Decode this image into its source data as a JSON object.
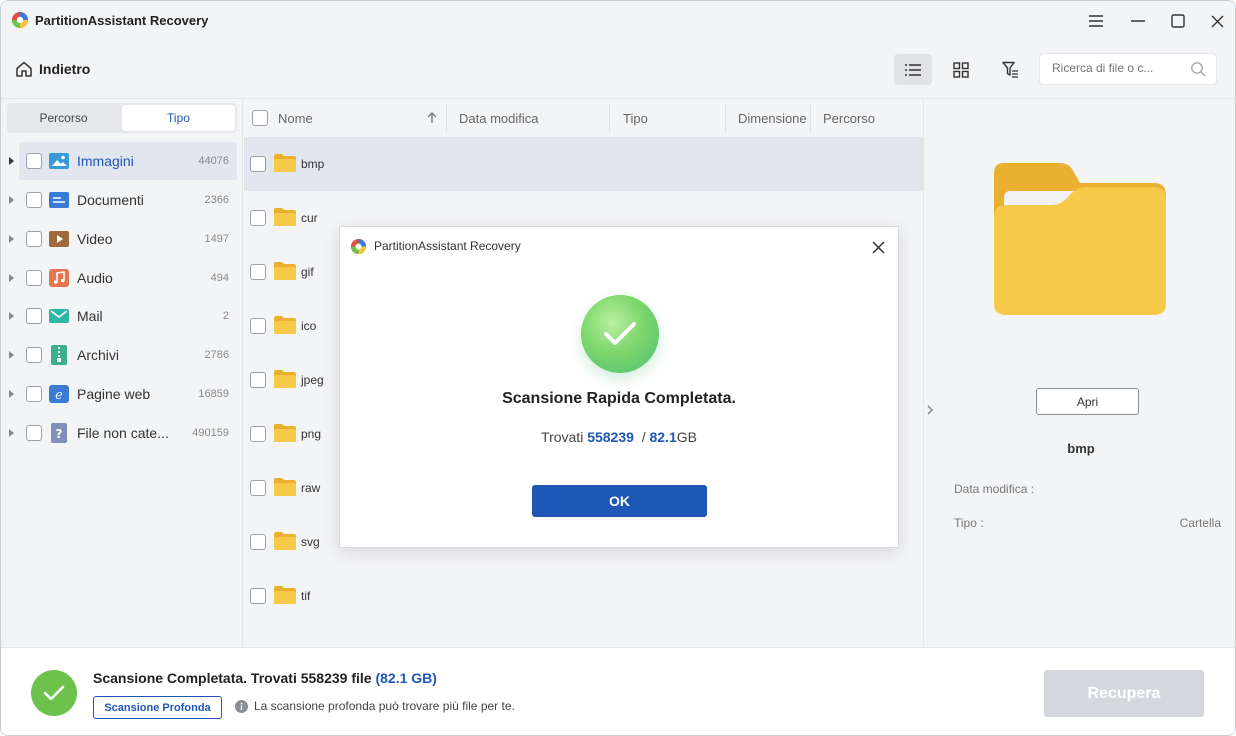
{
  "app": {
    "title": "PartitionAssistant Recovery"
  },
  "toolbar": {
    "back_label": "Indietro",
    "search_placeholder": "Ricerca di file o c..."
  },
  "left": {
    "tabs": [
      {
        "label": "Percorso"
      },
      {
        "label": "Tipo"
      }
    ],
    "categories": [
      {
        "label": "Immagini",
        "count": "44076",
        "icon": "image-icon",
        "color": "#3a9ad9"
      },
      {
        "label": "Documenti",
        "count": "2366",
        "icon": "document-icon",
        "color": "#3a7bd5"
      },
      {
        "label": "Video",
        "count": "1497",
        "icon": "video-icon",
        "color": "#a0693c"
      },
      {
        "label": "Audio",
        "count": "494",
        "icon": "audio-icon",
        "color": "#e8734f"
      },
      {
        "label": "Mail",
        "count": "2",
        "icon": "mail-icon",
        "color": "#2fb5a6"
      },
      {
        "label": "Archivi",
        "count": "2786",
        "icon": "archive-icon",
        "color": "#3aaf8c"
      },
      {
        "label": "Pagine web",
        "count": "16859",
        "icon": "web-icon",
        "color": "#3a7bd5"
      },
      {
        "label": "File non cate...",
        "count": "490159",
        "icon": "unknown-file-icon",
        "color": "#7f8fb8"
      }
    ]
  },
  "list": {
    "columns": {
      "name": "Nome",
      "date": "Data modifica",
      "type": "Tipo",
      "size": "Dimensione",
      "path": "Percorso"
    },
    "rows": [
      {
        "name": "bmp"
      },
      {
        "name": "cur"
      },
      {
        "name": "gif"
      },
      {
        "name": "ico"
      },
      {
        "name": "jpeg"
      },
      {
        "name": "png"
      },
      {
        "name": "raw"
      },
      {
        "name": "svg"
      },
      {
        "name": "tif"
      }
    ]
  },
  "preview": {
    "open_label": "Apri",
    "name": "bmp",
    "date_label": "Data modifica :",
    "type_label": "Tipo :",
    "type_value": "Cartella"
  },
  "bottom": {
    "status_text": "Scansione Completata. Trovati 558239 file",
    "status_size": "(82.1 GB)",
    "deep_scan_label": "Scansione Profonda",
    "hint": "La scansione profonda può trovare più file per te.",
    "recover_label": "Recupera"
  },
  "modal": {
    "title": "PartitionAssistant Recovery",
    "heading": "Scansione Rapida Completata.",
    "found_prefix": "Trovati",
    "found_count": "558239",
    "found_sep": "/",
    "found_size": "82.1",
    "found_unit": "GB",
    "ok_label": "OK"
  },
  "colors": {
    "accent": "#1f57b6",
    "success": "#6cc24a",
    "folder": "#f5c53d"
  }
}
